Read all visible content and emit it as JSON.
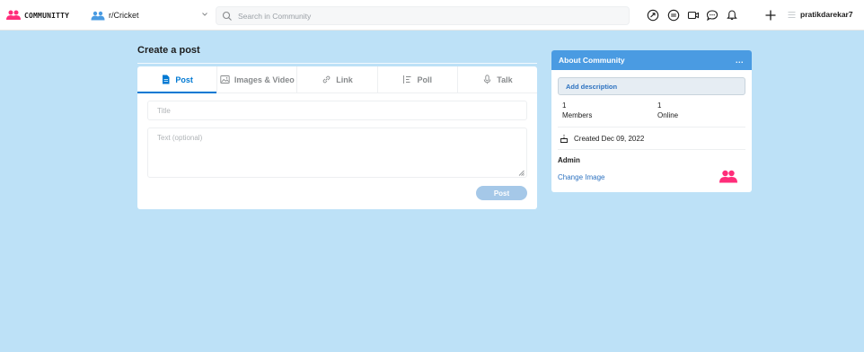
{
  "topbar": {
    "brand": "COMMUNITTY",
    "community": "r/Cricket",
    "search_placeholder": "Search in Community",
    "username": "pratikdarekar7",
    "icons": [
      "popular-icon",
      "coins-icon",
      "video-icon",
      "chat-icon",
      "bell-icon",
      "plus-icon",
      "menu-icon"
    ]
  },
  "create_post": {
    "heading": "Create a post",
    "tabs": [
      {
        "label": "Post",
        "icon": "post-icon",
        "active": true
      },
      {
        "label": "Images & Video",
        "icon": "image-icon",
        "active": false
      },
      {
        "label": "Link",
        "icon": "link-icon",
        "active": false
      },
      {
        "label": "Poll",
        "icon": "poll-icon",
        "active": false
      },
      {
        "label": "Talk",
        "icon": "mic-icon",
        "active": false
      }
    ],
    "title_placeholder": "Title",
    "text_placeholder": "Text (optional)",
    "post_button": "Post"
  },
  "about": {
    "heading": "About Community",
    "menu": "...",
    "add_description": "Add description",
    "members_count": "1",
    "members_label": "Members",
    "online_count": "1",
    "online_label": "Online",
    "created": "Created Dec 09, 2022",
    "admin": "Admin",
    "change_image": "Change Image"
  },
  "colors": {
    "background": "#bde1f7",
    "accent": "#0079d3",
    "about_header": "#4a9be2",
    "brand_pink": "#ff2d7a"
  }
}
